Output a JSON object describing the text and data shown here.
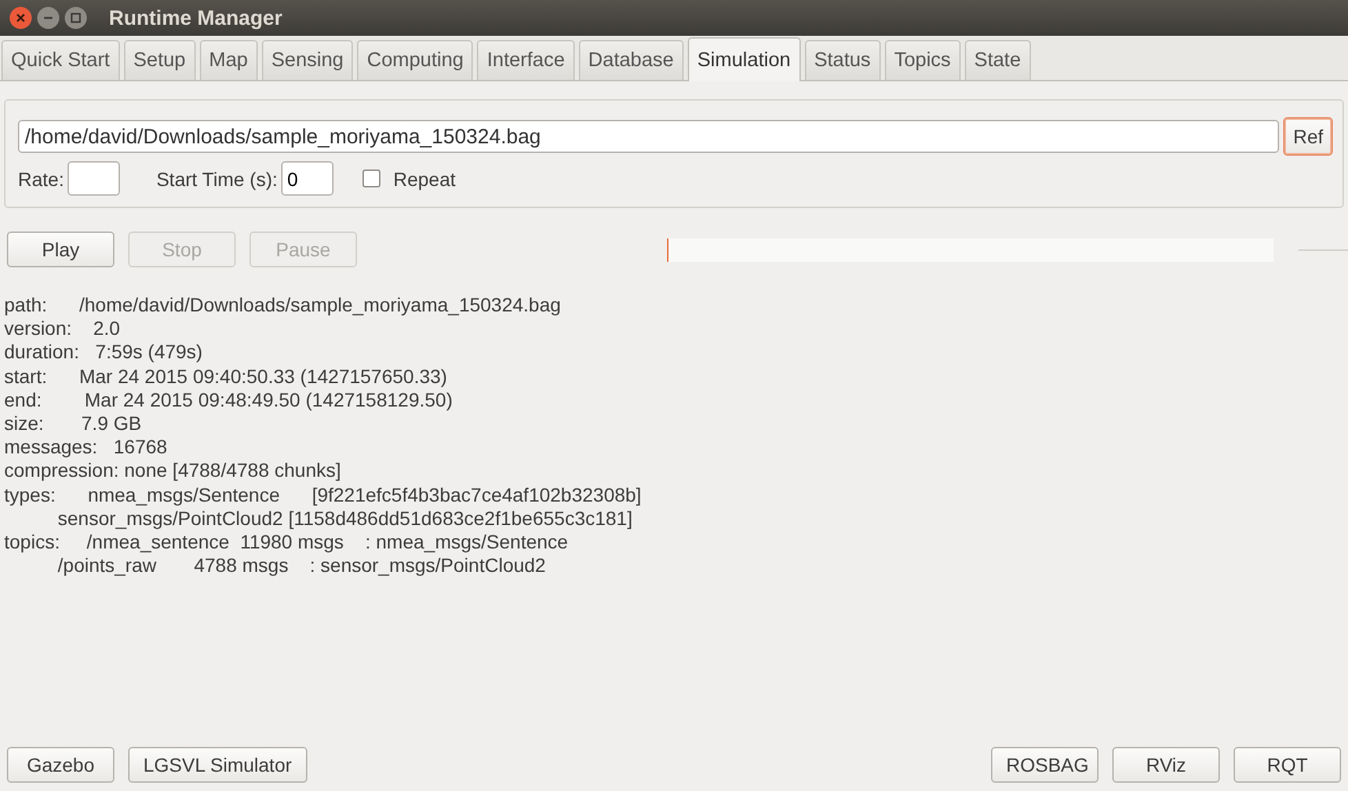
{
  "window": {
    "title": "Runtime Manager"
  },
  "tabs": [
    {
      "label": "Quick Start",
      "selected": false
    },
    {
      "label": "Setup",
      "selected": false
    },
    {
      "label": "Map",
      "selected": false
    },
    {
      "label": "Sensing",
      "selected": false
    },
    {
      "label": "Computing",
      "selected": false
    },
    {
      "label": "Interface",
      "selected": false
    },
    {
      "label": "Database",
      "selected": false
    },
    {
      "label": "Simulation",
      "selected": true
    },
    {
      "label": "Status",
      "selected": false
    },
    {
      "label": "Topics",
      "selected": false
    },
    {
      "label": "State",
      "selected": false
    }
  ],
  "file": {
    "value": "/home/david/Downloads/sample_moriyama_150324.bag",
    "button": "Ref"
  },
  "rate": {
    "label": "Rate:"
  },
  "start_time": {
    "label": "Start Time (s):",
    "value": "0"
  },
  "repeat": {
    "label": "Repeat",
    "checked": false
  },
  "progress": {
    "level": 0
  },
  "controls": [
    {
      "label": "Play",
      "disabled": false
    },
    {
      "label": "Stop",
      "disabled": true
    },
    {
      "label": "Pause",
      "disabled": true
    }
  ],
  "info": [
    "path:      /home/david/Downloads/sample_moriyama_150324.bag",
    "version:    2.0",
    "duration:   7:59s (479s)",
    "start:      Mar 24 2015 09:40:50.33 (1427157650.33)",
    "end:        Mar 24 2015 09:48:49.50 (1427158129.50)",
    "size:       7.9 GB",
    "messages:   16768",
    "compression: none [4788/4788 chunks]",
    "types:      nmea_msgs/Sentence      [9f221efc5f4b3bac7ce4af102b32308b]",
    "          sensor_msgs/PointCloud2 [1158d486dd51d683ce2f1be655c3c181]",
    "topics:     /nmea_sentence  11980 msgs    : nmea_msgs/Sentence",
    "          /points_raw       4788 msgs    : sensor_msgs/PointCloud2"
  ],
  "bottom_left": [
    "Gazebo",
    "LGSVL Simulator"
  ],
  "bottom_right": [
    "ROSBAG",
    "RViz",
    "RQT"
  ]
}
